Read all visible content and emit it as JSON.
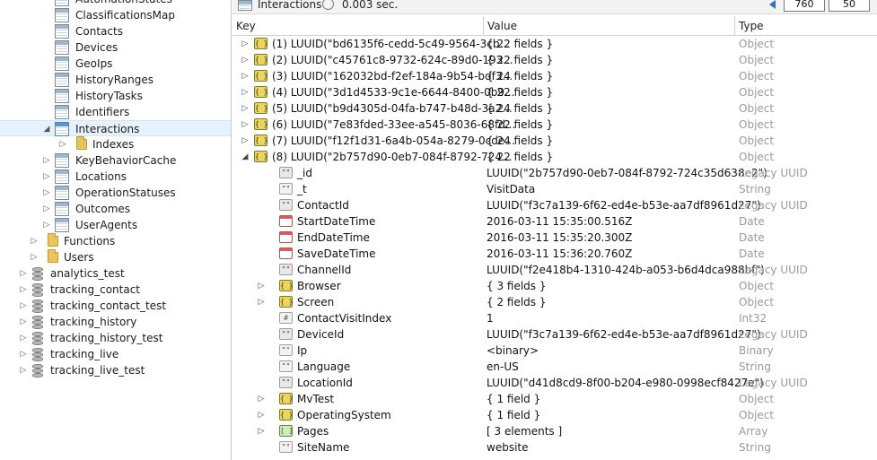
{
  "tree": {
    "items": [
      {
        "label": "AutomationStates",
        "icon": "table-icon",
        "expand": "none",
        "indent": 2
      },
      {
        "label": "ClassificationsMap",
        "icon": "table-icon",
        "expand": "none",
        "indent": 2
      },
      {
        "label": "Contacts",
        "icon": "table-icon",
        "expand": "none",
        "indent": 2
      },
      {
        "label": "Devices",
        "icon": "table-icon",
        "expand": "none",
        "indent": 2
      },
      {
        "label": "GeoIps",
        "icon": "table-icon",
        "expand": "none",
        "indent": 2
      },
      {
        "label": "HistoryRanges",
        "icon": "table-icon",
        "expand": "none",
        "indent": 2
      },
      {
        "label": "HistoryTasks",
        "icon": "table-icon",
        "expand": "none",
        "indent": 2
      },
      {
        "label": "Identifiers",
        "icon": "table-icon",
        "expand": "none",
        "indent": 2
      },
      {
        "label": "Interactions",
        "icon": "table-icon",
        "expand": "open",
        "indent": 2,
        "selected": true
      },
      {
        "label": "Indexes",
        "icon": "folder-icon",
        "expand": "closed",
        "indent": 3
      },
      {
        "label": "KeyBehaviorCache",
        "icon": "table-icon",
        "expand": "closed",
        "indent": 2
      },
      {
        "label": "Locations",
        "icon": "table-icon",
        "expand": "closed",
        "indent": 2
      },
      {
        "label": "OperationStatuses",
        "icon": "table-icon",
        "expand": "closed",
        "indent": 2
      },
      {
        "label": "Outcomes",
        "icon": "table-icon",
        "expand": "closed",
        "indent": 2
      },
      {
        "label": "UserAgents",
        "icon": "table-icon",
        "expand": "closed",
        "indent": 2
      },
      {
        "label": "Functions",
        "icon": "folder-icon",
        "expand": "closed",
        "indent": 1
      },
      {
        "label": "Users",
        "icon": "folder-icon",
        "expand": "closed",
        "indent": 1
      },
      {
        "label": "analytics_test",
        "icon": "database-icon",
        "expand": "closed",
        "indent": 0
      },
      {
        "label": "tracking_contact",
        "icon": "database-icon",
        "expand": "closed",
        "indent": 0
      },
      {
        "label": "tracking_contact_test",
        "icon": "database-icon",
        "expand": "closed",
        "indent": 0
      },
      {
        "label": "tracking_history",
        "icon": "database-icon",
        "expand": "closed",
        "indent": 0
      },
      {
        "label": "tracking_history_test",
        "icon": "database-icon",
        "expand": "closed",
        "indent": 0
      },
      {
        "label": "tracking_live",
        "icon": "database-icon",
        "expand": "closed",
        "indent": 0
      },
      {
        "label": "tracking_live_test",
        "icon": "database-icon",
        "expand": "closed",
        "indent": 0
      }
    ]
  },
  "toolbar": {
    "collection": "Interactions",
    "collection_icon": "table-icon",
    "time": "0.003 sec.",
    "time_icon": "clock-icon",
    "page_size": "760",
    "limit": "50",
    "nav_icon": "arrow-left-icon"
  },
  "columns": {
    "key": "Key",
    "value": "Value",
    "type": "Type"
  },
  "rows": [
    {
      "level": 0,
      "expand": "closed",
      "icon": "object",
      "key": "(1) LUUID(\"bd6135f6-cedd-5c49-9564-3cb...",
      "value": "{ 22 fields }",
      "type": "Object"
    },
    {
      "level": 0,
      "expand": "closed",
      "icon": "object",
      "key": "(2) LUUID(\"c45761c8-9732-624c-89d0-193...",
      "value": "{ 22 fields }",
      "type": "Object"
    },
    {
      "level": 0,
      "expand": "closed",
      "icon": "object",
      "key": "(3) LUUID(\"162032bd-f2ef-184a-9b54-bdf3...",
      "value": "{ 24 fields }",
      "type": "Object"
    },
    {
      "level": 0,
      "expand": "closed",
      "icon": "object",
      "key": "(4) LUUID(\"3d1d4533-9c1e-6644-8400-0b9...",
      "value": "{ 22 fields }",
      "type": "Object"
    },
    {
      "level": 0,
      "expand": "closed",
      "icon": "object",
      "key": "(5) LUUID(\"b9d4305d-04fa-b747-b48d-3a2...",
      "value": "{ 24 fields }",
      "type": "Object"
    },
    {
      "level": 0,
      "expand": "closed",
      "icon": "object",
      "key": "(6) LUUID(\"7e83fded-33ee-a545-8036-68fd...",
      "value": "{ 22 fields }",
      "type": "Object"
    },
    {
      "level": 0,
      "expand": "closed",
      "icon": "object",
      "key": "(7) LUUID(\"f12f1d31-6a4b-054a-8279-0cde...",
      "value": "{ 24 fields }",
      "type": "Object"
    },
    {
      "level": 0,
      "expand": "open",
      "icon": "object",
      "key": "(8) LUUID(\"2b757d90-0eb7-084f-8792-724...",
      "value": "{ 22 fields }",
      "type": "Object"
    },
    {
      "level": 1,
      "expand": "none",
      "icon": "uuid",
      "key": "_id",
      "value": "LUUID(\"2b757d90-0eb7-084f-8792-724c35d638e2\")",
      "type": "Legacy UUID"
    },
    {
      "level": 1,
      "expand": "none",
      "icon": "string",
      "key": "_t",
      "value": "VisitData",
      "type": "String"
    },
    {
      "level": 1,
      "expand": "none",
      "icon": "uuid",
      "key": "ContactId",
      "value": "LUUID(\"f3c7a139-6f62-ed4e-b53e-aa7df8961d27\")",
      "type": "Legacy UUID"
    },
    {
      "level": 1,
      "expand": "none",
      "icon": "date",
      "key": "StartDateTime",
      "value": "2016-03-11 15:35:00.516Z",
      "type": "Date"
    },
    {
      "level": 1,
      "expand": "none",
      "icon": "date",
      "key": "EndDateTime",
      "value": "2016-03-11 15:35:20.300Z",
      "type": "Date"
    },
    {
      "level": 1,
      "expand": "none",
      "icon": "date",
      "key": "SaveDateTime",
      "value": "2016-03-11 15:36:20.760Z",
      "type": "Date"
    },
    {
      "level": 1,
      "expand": "none",
      "icon": "uuid",
      "key": "ChannelId",
      "value": "LUUID(\"f2e418b4-1310-424b-a053-b6d4dca988bf\")",
      "type": "Legacy UUID"
    },
    {
      "level": 1,
      "expand": "closed",
      "icon": "object",
      "key": "Browser",
      "value": "{ 3 fields }",
      "type": "Object"
    },
    {
      "level": 1,
      "expand": "closed",
      "icon": "object",
      "key": "Screen",
      "value": "{ 2 fields }",
      "type": "Object"
    },
    {
      "level": 1,
      "expand": "none",
      "icon": "int",
      "key": "ContactVisitIndex",
      "value": "1",
      "type": "Int32"
    },
    {
      "level": 1,
      "expand": "none",
      "icon": "uuid",
      "key": "DeviceId",
      "value": "LUUID(\"f3c7a139-6f62-ed4e-b53e-aa7df8961d27\")",
      "type": "Legacy UUID"
    },
    {
      "level": 1,
      "expand": "none",
      "icon": "binary",
      "key": "Ip",
      "value": "<binary>",
      "type": "Binary"
    },
    {
      "level": 1,
      "expand": "none",
      "icon": "string",
      "key": "Language",
      "value": "en-US",
      "type": "String"
    },
    {
      "level": 1,
      "expand": "none",
      "icon": "uuid",
      "key": "LocationId",
      "value": "LUUID(\"d41d8cd9-8f00-b204-e980-0998ecf8427e\")",
      "type": "Legacy UUID"
    },
    {
      "level": 1,
      "expand": "closed",
      "icon": "object",
      "key": "MvTest",
      "value": "{ 1 field }",
      "type": "Object"
    },
    {
      "level": 1,
      "expand": "closed",
      "icon": "object",
      "key": "OperatingSystem",
      "value": "{ 1 field }",
      "type": "Object"
    },
    {
      "level": 1,
      "expand": "closed",
      "icon": "array",
      "key": "Pages",
      "value": "[ 3 elements ]",
      "type": "Array"
    },
    {
      "level": 1,
      "expand": "none",
      "icon": "string",
      "key": "SiteName",
      "value": "website",
      "type": "String"
    }
  ]
}
